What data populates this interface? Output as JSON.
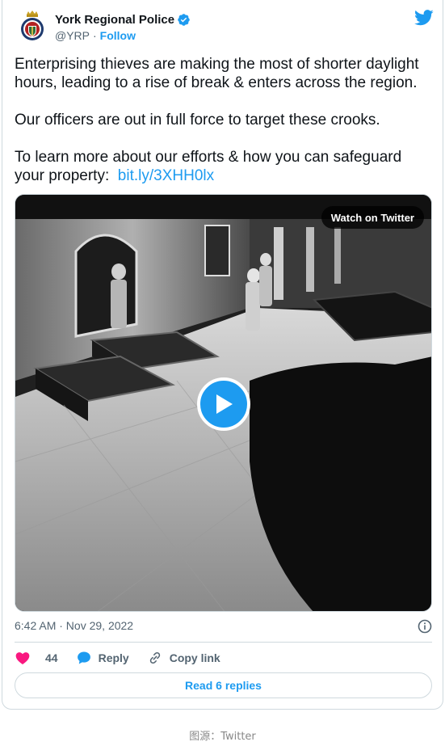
{
  "author": {
    "name": "York Regional Police",
    "handle": "@YRP",
    "separator": "·",
    "follow_label": "Follow"
  },
  "tweet": {
    "paragraph_1": "Enterprising thieves are making the most of shorter daylight hours, leading to a rise of break & enters across the region.",
    "paragraph_2": "Our officers are out in full force to target these crooks.",
    "paragraph_3": "To learn more about our efforts & how you can safeguard your property:",
    "link": "bit.ly/3XHH0lx"
  },
  "media": {
    "watch_label": "Watch on Twitter"
  },
  "meta": {
    "timestamp": "6:42 AM · Nov 29, 2022"
  },
  "actions": {
    "likes": "44",
    "reply_label": "Reply",
    "copy_label": "Copy link"
  },
  "read_replies_label": "Read 6 replies",
  "caption": "图源：Twitter",
  "colors": {
    "accent": "#1d9bf0",
    "like": "#f91880",
    "text": "#0f1419",
    "muted": "#536471",
    "border": "#cfd9de"
  },
  "icons": [
    "police-badge-avatar",
    "verified-badge-icon",
    "twitter-bird-icon",
    "play-icon",
    "info-icon",
    "heart-icon",
    "reply-bubble-icon",
    "link-icon"
  ]
}
